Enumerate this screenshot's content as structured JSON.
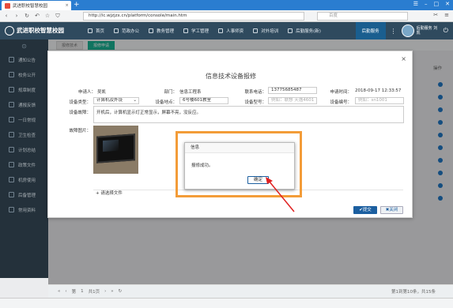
{
  "browser": {
    "tab_title": "武进职校智慧校园",
    "url": "http://ic.wjzjzx.cn/platform/console/main.htm",
    "search_placeholder": "百度"
  },
  "app": {
    "logo": "武进职校智慧校园",
    "menu": [
      {
        "label": "首页",
        "icon": "home-icon"
      },
      {
        "label": "范政办公",
        "icon": "briefcase-icon"
      },
      {
        "label": "教务管理",
        "icon": "book-icon"
      },
      {
        "label": "学工管理",
        "icon": "user-icon"
      },
      {
        "label": "人事师资",
        "icon": "people-icon"
      },
      {
        "label": "对外培训",
        "icon": "chart-icon"
      },
      {
        "label": "后勤服务(新)",
        "icon": "tools-icon"
      }
    ],
    "quick_label": "后勤服务",
    "user_name": "后勤服务 刘凯"
  },
  "sidebar": {
    "items": [
      {
        "label": "通知公告",
        "icon": "bell-icon"
      },
      {
        "label": "校务公开",
        "icon": "doc-icon"
      },
      {
        "label": "规章制度",
        "icon": "rules-icon"
      },
      {
        "label": "通报反馈",
        "icon": "chat-icon"
      },
      {
        "label": "一日常规",
        "icon": "list-icon"
      },
      {
        "label": "卫生检查",
        "icon": "check-icon"
      },
      {
        "label": "计划总结",
        "icon": "plan-icon"
      },
      {
        "label": "政策文件",
        "icon": "file-icon"
      },
      {
        "label": "机房使用",
        "icon": "monitor-icon"
      },
      {
        "label": "后备管理",
        "icon": "store-icon"
      },
      {
        "label": "常用资料",
        "icon": "folder-icon"
      }
    ]
  },
  "subtabs": [
    "报修技术",
    "报修申请"
  ],
  "table": {
    "op_header": "操作"
  },
  "pager": {
    "page_label": "第",
    "page_num": "1",
    "total": "共1页",
    "info": "第1到第10条，共15条"
  },
  "modal": {
    "title": "信息技术设备报修",
    "applicant_label": "申请人：",
    "applicant": "吴凯",
    "dept_label": "部门：",
    "dept": "信息工程系",
    "phone_label": "联系电话：",
    "phone": "13775685487",
    "apply_time_label": "申请时间：",
    "apply_time": "2018-09-17 12:33:57",
    "device_type_label": "设备类型：",
    "device_type": "计算机及外设",
    "location_label": "设备地点：",
    "location": "6号楼601教室",
    "model_label": "设备型号：",
    "model_placeholder": "例如：联想 天逸4601",
    "number_label": "设备编号：",
    "number_placeholder": "例如：sn1001",
    "fault_label": "设备故障：",
    "fault": "开机后，计算机显示灯正常显示，屏幕不亮，没反应。",
    "photo_label": "故障图片：",
    "file_button": "+ 请选择文件",
    "submit": "提交",
    "close": "关闭"
  },
  "alert": {
    "title": "信息",
    "message": "报修成功。",
    "ok": "确定"
  },
  "colors": {
    "accent": "#f39c38",
    "primary": "#1c5fa0",
    "header": "#2f4a5e",
    "sidebar": "#2d3e4a"
  }
}
